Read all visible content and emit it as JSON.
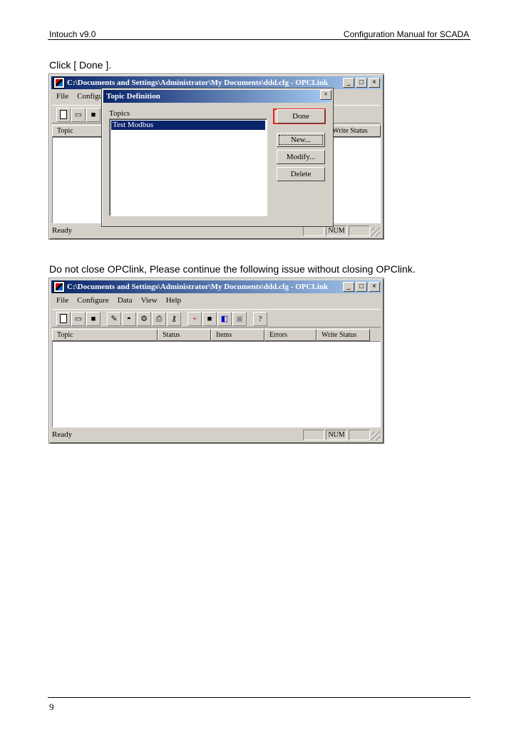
{
  "header": {
    "left": "Intouch v9.0",
    "right": "Configuration Manual for SCADA"
  },
  "paragraphs": {
    "p1": "Click [ Done ].",
    "p2": "Do not close OPClink, Please continue the following issue without closing OPClink."
  },
  "window": {
    "title": "C:\\Documents and Settings\\Administrator\\My Documents\\ddd.cfg - OPCLink",
    "menu_truncated": [
      "File",
      "Configu"
    ],
    "menu": [
      "File",
      "Configure",
      "Data",
      "View",
      "Help"
    ],
    "columns": [
      "Topic",
      "Status",
      "Items",
      "Errors",
      "Write Status"
    ],
    "status_ready": "Ready",
    "status_num": "NUM"
  },
  "dialog": {
    "title": "Topic Definition",
    "topics_label": "Topics",
    "topic_item": "Test Modbus",
    "buttons": {
      "done": "Done",
      "new": "New...",
      "modify": "Modify...",
      "delete": "Delete"
    }
  },
  "footer": {
    "page_number": "9"
  },
  "icons": [
    "app-icon",
    "new-file-icon",
    "open-folder-icon",
    "save-icon",
    "help-icon"
  ]
}
